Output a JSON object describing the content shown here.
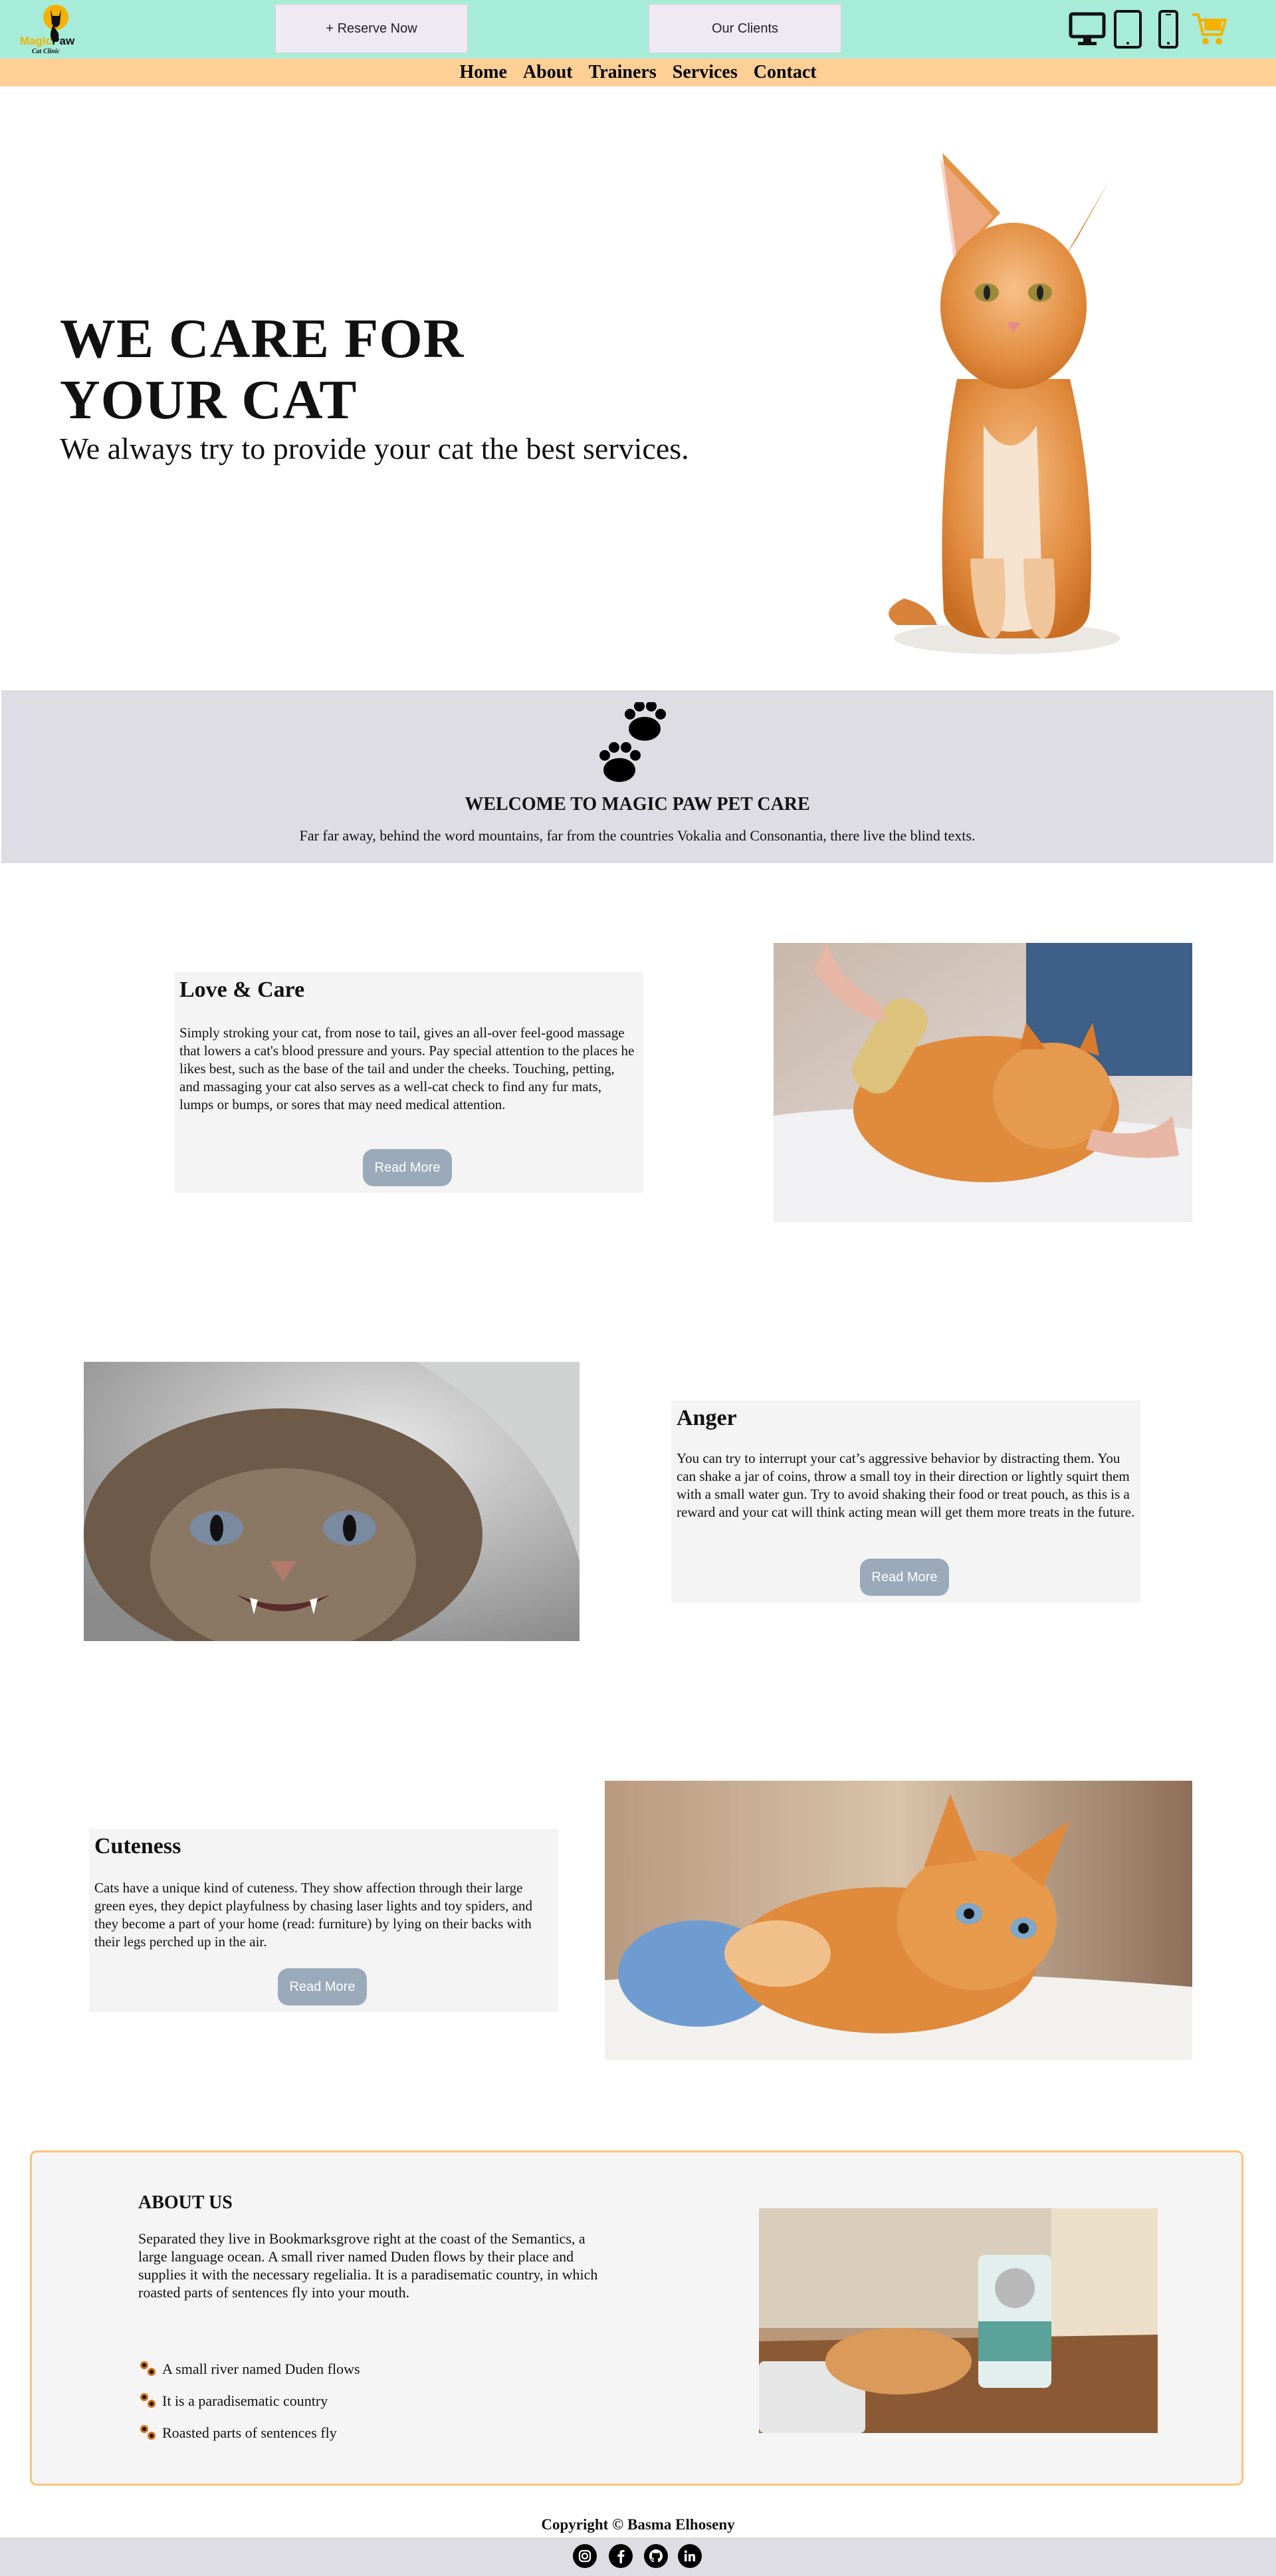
{
  "brand": {
    "logo_word_1": "Magic",
    "logo_word_2": "Paw",
    "logo_tagline": "Cat Clinic"
  },
  "header": {
    "reserve_label": "+ Reserve Now",
    "clients_label": "Our Clients"
  },
  "devices": [
    "desktop-icon",
    "tablet-icon",
    "phone-icon",
    "cart-icon"
  ],
  "nav": {
    "home": "Home",
    "about": "About",
    "trainers": "Trainers",
    "services": "Services",
    "contact": "Contact"
  },
  "hero": {
    "title_line1": "WE CARE FOR",
    "title_line2": "YOUR CAT",
    "subtitle": "We always try to provide your cat the best services."
  },
  "welcome": {
    "title": "WELCOME TO MAGIC PAW PET CARE",
    "text": "Far far away, behind the word mountains, far from the countries Vokalia and Consonantia, there live the blind texts."
  },
  "cards": [
    {
      "title": "Love & Care",
      "text": "Simply stroking your cat, from nose to tail, gives an all-over feel-good massage that lowers a cat's blood pressure and yours. Pay special attention to the places he likes best, such as the base of the tail and under the cheeks. Touching, petting, and massaging your cat also serves as a well-cat check to find any fur mats, lumps or bumps, or sores that may need medical attention.",
      "button": "Read More"
    },
    {
      "title": "Anger",
      "text": "You can try to interrupt your cat’s aggressive behavior by distracting them. You can shake a jar of coins, throw a small toy in their direction or lightly squirt them with a small water gun. Try to avoid shaking their food or treat pouch, as this is a reward and your cat will think acting mean will get them more treats in the future.",
      "button": "Read More"
    },
    {
      "title": "Cuteness",
      "text": "Cats have a unique kind of cuteness. They show affection through their large green eyes, they depict playfulness by chasing laser lights and toy spiders, and they become a part of your home (read: furniture) by lying on their backs with their legs perched up in the air.",
      "button": "Read More"
    }
  ],
  "about": {
    "title": "ABOUT US",
    "text": "Separated they live in Bookmarksgrove right at the coast of the Semantics, a large language ocean. A small river named Duden flows by their place and supplies it with the necessary regelialia. It is a paradisematic country, in which roasted parts of sentences fly into your mouth.",
    "list": [
      "A small river named Duden flows",
      "It is a paradisematic country",
      "Roasted parts of sentences fly"
    ]
  },
  "footer": {
    "copyright": "Copyright © Basma Elhoseny",
    "social": [
      "instagram-icon",
      "facebook-icon",
      "github-icon",
      "linkedin-icon"
    ]
  },
  "colors": {
    "topbar": "#a6ecd8",
    "navbar": "#ffcf96",
    "button": "#9aaabb",
    "accent": "#ffc27a",
    "cart": "#f5b100"
  }
}
